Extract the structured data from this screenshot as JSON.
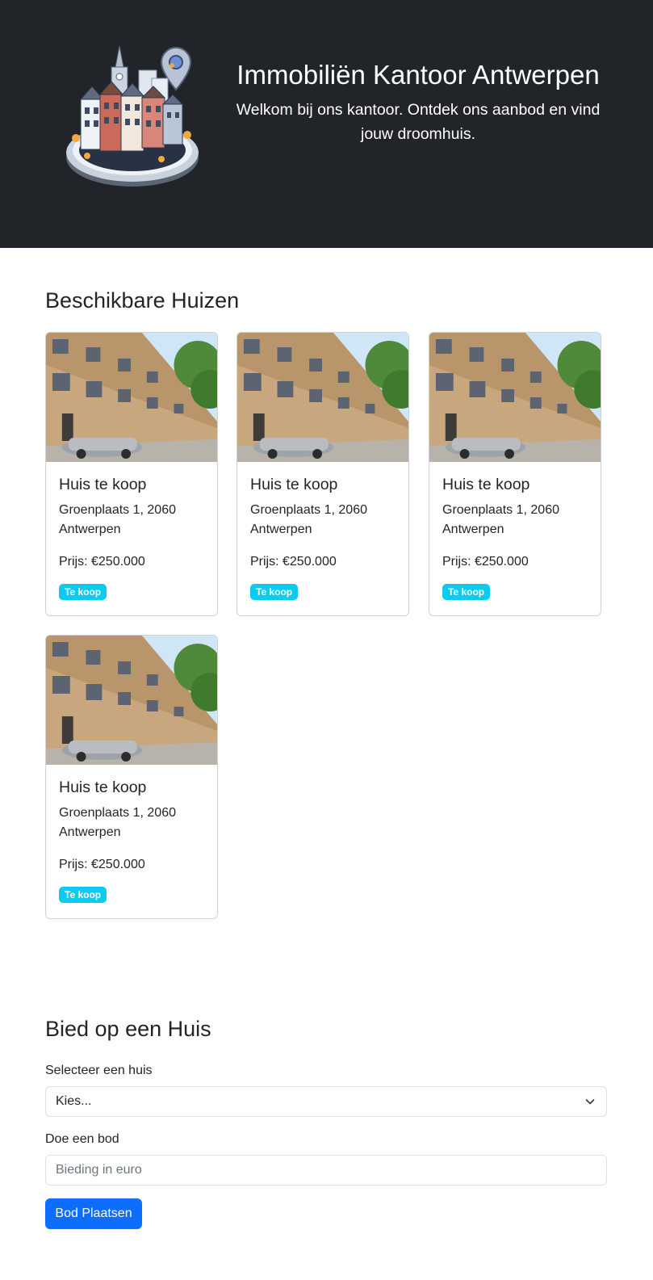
{
  "hero": {
    "title": "Immobiliën Kantoor Antwerpen",
    "lead": "Welkom bij ons kantoor. Ontdek ons aanbod en vind jouw droomhuis."
  },
  "houses_section": {
    "title": "Beschikbare Huizen",
    "cards": [
      {
        "title": "Huis te koop",
        "address": "Groenplaats 1, 2060 Antwerpen",
        "price": "Prijs: €250.000",
        "badge": "Te koop"
      },
      {
        "title": "Huis te koop",
        "address": "Groenplaats 1, 2060 Antwerpen",
        "price": "Prijs: €250.000",
        "badge": "Te koop"
      },
      {
        "title": "Huis te koop",
        "address": "Groenplaats 1, 2060 Antwerpen",
        "price": "Prijs: €250.000",
        "badge": "Te koop"
      },
      {
        "title": "Huis te koop",
        "address": "Groenplaats 1, 2060 Antwerpen",
        "price": "Prijs: €250.000",
        "badge": "Te koop"
      }
    ]
  },
  "bid_section": {
    "title": "Bied op een Huis",
    "select_label": "Selecteer een huis",
    "select_value": "Kies...",
    "bid_label": "Doe een bod",
    "bid_placeholder": "Bieding in euro",
    "submit_label": "Bod Plaatsen"
  },
  "colors": {
    "header_bg": "#212529",
    "badge": "#0dcaf0",
    "primary": "#0d6efd"
  },
  "icons": {
    "logo": "city-houses-location-pin-logo",
    "select": "chevron-down-icon"
  }
}
